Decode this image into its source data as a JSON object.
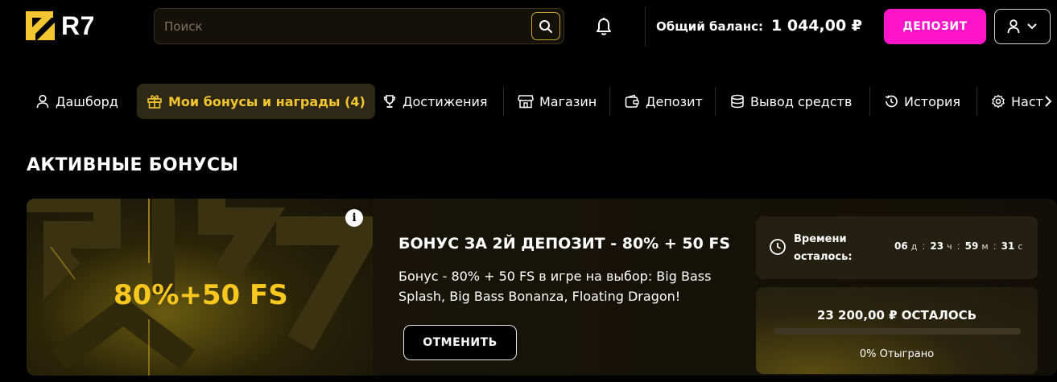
{
  "header": {
    "logo_text": "R7",
    "search_placeholder": "Поиск",
    "balance_label": "Общий баланс:",
    "balance_value": "1 044,00 ₽",
    "deposit_label": "ДЕПОЗИТ",
    "brand_color": "#f2c531",
    "deposit_color": "#ff14c9"
  },
  "nav": {
    "items": [
      {
        "label": "Дашборд",
        "icon": "user-icon"
      },
      {
        "label": "Мои бонусы и награды (4)",
        "icon": "gift-icon",
        "active": true
      },
      {
        "label": "Достижения",
        "icon": "trophy-icon"
      },
      {
        "label": "Магазин",
        "icon": "store-icon"
      },
      {
        "label": "Депозит",
        "icon": "wallet-icon"
      },
      {
        "label": "Вывод средств",
        "icon": "coins-icon"
      },
      {
        "label": "История",
        "icon": "history-icon"
      },
      {
        "label": "Наст",
        "icon": "gear-icon"
      }
    ]
  },
  "section": {
    "title": "АКТИВНЫЕ БОНУСЫ"
  },
  "bonus": {
    "image_text": "80%+50 FS",
    "title": "БОНУС ЗА 2Й ДЕПОЗИТ - 80% + 50 FS",
    "description": "Бонус - 80% + 50 FS в игре на выбор: Big Bass Splash, Big Bass Bonanza, Floating Dragon!",
    "cancel_label": "ОТМЕНИТЬ",
    "timer": {
      "label": "Времени осталось:",
      "days": "06",
      "days_unit": "д",
      "hours": "23",
      "hours_unit": "ч",
      "minutes": "59",
      "minutes_unit": "м",
      "seconds": "31",
      "seconds_unit": "с"
    },
    "wager": {
      "remaining": "23 200,00 ₽ ОСТАЛОСЬ",
      "progress_label": "0% Отыграно",
      "progress_fraction": 0
    }
  }
}
